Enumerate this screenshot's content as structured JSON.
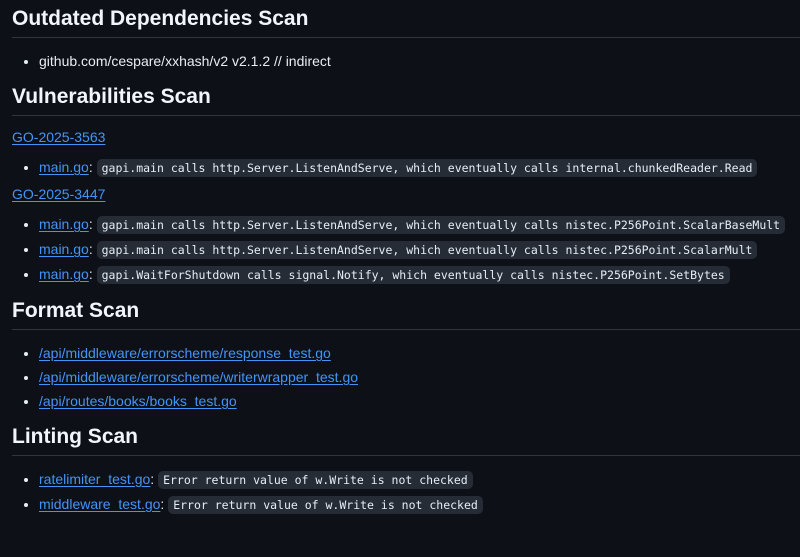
{
  "outdated": {
    "heading": "Outdated Dependencies Scan",
    "items": [
      "github.com/cespare/xxhash/v2 v2.1.2 // indirect"
    ]
  },
  "vulnerabilities": {
    "heading": "Vulnerabilities Scan",
    "groups": [
      {
        "id": "GO-2025-3563",
        "items": [
          {
            "file": "main.go",
            "sep": ": ",
            "detail": "gapi.main calls http.Server.ListenAndServe, which eventually calls internal.chunkedReader.Read"
          }
        ]
      },
      {
        "id": "GO-2025-3447",
        "items": [
          {
            "file": "main.go",
            "sep": ": ",
            "detail": "gapi.main calls http.Server.ListenAndServe, which eventually calls nistec.P256Point.ScalarBaseMult"
          },
          {
            "file": "main.go",
            "sep": ": ",
            "detail": "gapi.main calls http.Server.ListenAndServe, which eventually calls nistec.P256Point.ScalarMult"
          },
          {
            "file": "main.go",
            "sep": ": ",
            "detail": "gapi.WaitForShutdown calls signal.Notify, which eventually calls nistec.P256Point.SetBytes"
          }
        ]
      }
    ]
  },
  "format": {
    "heading": "Format Scan",
    "items": [
      "/api/middleware/errorscheme/response_test.go",
      "/api/middleware/errorscheme/writerwrapper_test.go",
      "/api/routes/books/books_test.go"
    ]
  },
  "linting": {
    "heading": "Linting Scan",
    "items": [
      {
        "file": "ratelimiter_test.go",
        "sep": ": ",
        "detail": "Error return value of w.Write is not checked"
      },
      {
        "file": "middleware_test.go",
        "sep": ": ",
        "detail": "Error return value of w.Write is not checked"
      }
    ]
  },
  "colors": {
    "background": "#0d1117",
    "text": "#e6edf3",
    "link": "#4493f8",
    "code_bg": "#262c36",
    "divider": "#30363d"
  }
}
